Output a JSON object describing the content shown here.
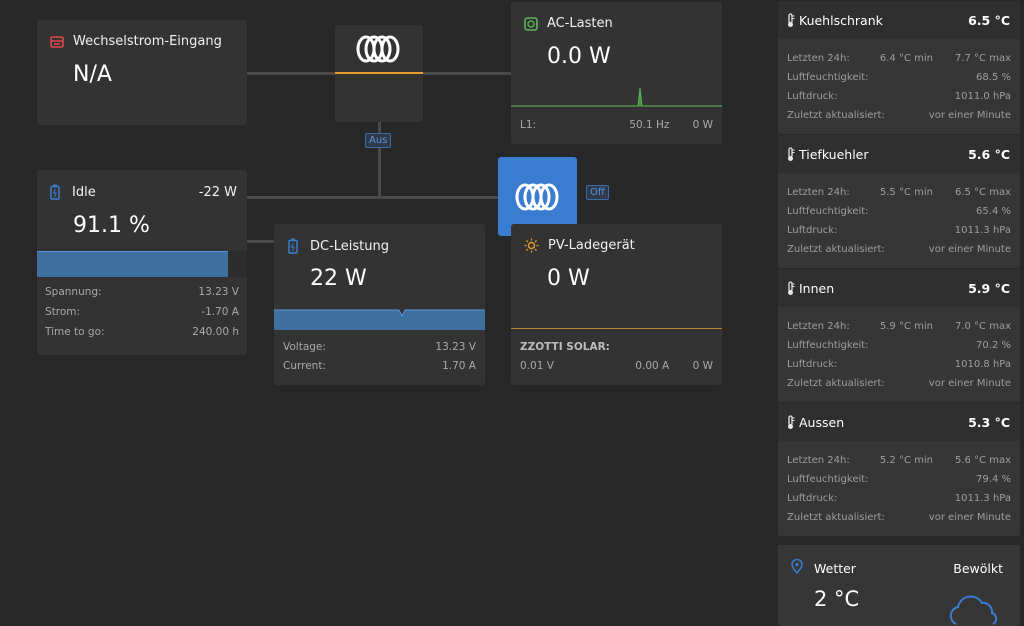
{
  "colors": {
    "accent_blue": "#3a7cd0",
    "graph_blue": "#3f6f9f",
    "orange": "#e89b2a",
    "green_spike": "#5cb85c",
    "ac_input_red": "#e0474c"
  },
  "ac_input": {
    "title": "Wechselstrom-Eingang",
    "value": "N/A",
    "icon": "ac-input-icon"
  },
  "inverter": {
    "icon": "victron-logo"
  },
  "inverter_tag": "Aus",
  "ac_loads": {
    "title": "AC-Lasten",
    "value": "0.0 W",
    "icon": "outlet-icon",
    "row": {
      "label": "L1:",
      "freq": "50.1 Hz",
      "power": "0 W"
    }
  },
  "battery": {
    "title": "Idle",
    "power": "-22 W",
    "soc": "91.1 %",
    "soc_fraction": 0.911,
    "icon": "battery-icon",
    "rows": [
      {
        "label": "Spannung:",
        "value": "13.23 V"
      },
      {
        "label": "Strom:",
        "value": "-1.70 A"
      },
      {
        "label": "Time to go:",
        "value": "240.00 h"
      }
    ]
  },
  "charger_tag": "Off",
  "dc_power": {
    "title": "DC-Leistung",
    "value": "22 W",
    "icon": "battery-icon",
    "rows": [
      {
        "label": "Voltage:",
        "value": "13.23 V"
      },
      {
        "label": "Current:",
        "value": "1.70 A"
      }
    ]
  },
  "pv": {
    "title": "PV-Ladegerät",
    "value": "0 W",
    "icon": "sun-icon",
    "device": "ZZOTTI SOLAR:",
    "voltage": "0.01 V",
    "current": "0.00 A",
    "power": "0 W"
  },
  "sensors": [
    {
      "name": "Kuehlschrank",
      "temp": "6.5 °C",
      "l24": "Letzten 24h:",
      "min": "6.4 °C min",
      "max": "7.7 °C max",
      "hum_label": "Luftfeuchtigkeit:",
      "hum": "68.5 %",
      "press_label": "Luftdruck:",
      "press": "1011.0 hPa",
      "upd_label": "Zuletzt aktualisiert:",
      "upd": "vor einer Minute"
    },
    {
      "name": "Tiefkuehler",
      "temp": "5.6 °C",
      "l24": "Letzten 24h:",
      "min": "5.5 °C min",
      "max": "6.5 °C max",
      "hum_label": "Luftfeuchtigkeit:",
      "hum": "65.4 %",
      "press_label": "Luftdruck:",
      "press": "1011.3 hPa",
      "upd_label": "Zuletzt aktualisiert:",
      "upd": "vor einer Minute"
    },
    {
      "name": "Innen",
      "temp": "5.9 °C",
      "l24": "Letzten 24h:",
      "min": "5.9 °C min",
      "max": "7.0 °C max",
      "hum_label": "Luftfeuchtigkeit:",
      "hum": "70.2 %",
      "press_label": "Luftdruck:",
      "press": "1010.8 hPa",
      "upd_label": "Zuletzt aktualisiert:",
      "upd": "vor einer Minute"
    },
    {
      "name": "Aussen",
      "temp": "5.3 °C",
      "l24": "Letzten 24h:",
      "min": "5.2 °C min",
      "max": "5.6 °C max",
      "hum_label": "Luftfeuchtigkeit:",
      "hum": "79.4 %",
      "press_label": "Luftdruck:",
      "press": "1011.3 hPa",
      "upd_label": "Zuletzt aktualisiert:",
      "upd": "vor einer Minute"
    }
  ],
  "weather": {
    "title": "Wetter",
    "condition": "Bewölkt",
    "temp": "2 °C",
    "icon": "cloud-icon"
  }
}
